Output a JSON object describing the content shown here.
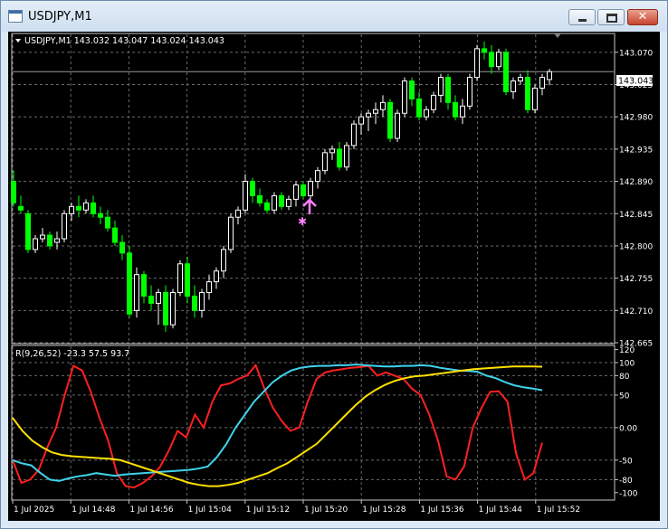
{
  "window": {
    "title": "USDJPY,M1",
    "minimize_glyph": "–",
    "maximize_glyph": "□",
    "close_glyph": "✕"
  },
  "main_chart": {
    "header": "USDJPY,M1  143.032 143.047 143.024 143.043",
    "current_price": "143.043",
    "bg_color": "#000000",
    "bull_color": "#ffffff",
    "bear_color": "#00ff00",
    "price_axis_ticks": [
      "143.070",
      "143.025",
      "142.980",
      "142.935",
      "142.890",
      "142.845",
      "142.800",
      "142.755",
      "142.710",
      "142.665"
    ]
  },
  "indicator": {
    "header": "R(9,26,52) -23.3 57.5 93.7",
    "axis_ticks": [
      "120",
      "100",
      "80",
      "50",
      "0.00",
      "-50",
      "-80",
      "-100"
    ]
  },
  "time_axis": [
    "1 Jul 2025",
    "1 Jul 14:48",
    "1 Jul 14:56",
    "1 Jul 15:04",
    "1 Jul 15:12",
    "1 Jul 15:20",
    "1 Jul 15:28",
    "1 Jul 15:36",
    "1 Jul 15:44",
    "1 Jul 15:52"
  ],
  "chart_data": [
    {
      "type": "candlestick",
      "title": "USDJPY,M1",
      "ylim": [
        142.665,
        143.095
      ],
      "series": [
        {
          "name": "USDJPY",
          "ohlc": [
            [
              142.89,
              142.905,
              142.855,
              142.86
            ],
            [
              142.855,
              142.87,
              142.845,
              142.85
            ],
            [
              142.845,
              142.85,
              142.79,
              142.795
            ],
            [
              142.795,
              142.815,
              142.79,
              142.81
            ],
            [
              142.81,
              142.825,
              142.805,
              142.815
            ],
            [
              142.815,
              142.82,
              142.795,
              142.8
            ],
            [
              142.805,
              142.82,
              142.795,
              142.81
            ],
            [
              142.81,
              142.85,
              142.805,
              142.845
            ],
            [
              142.845,
              142.86,
              142.835,
              142.855
            ],
            [
              142.855,
              142.87,
              142.84,
              142.85
            ],
            [
              142.85,
              142.865,
              142.845,
              142.86
            ],
            [
              142.86,
              142.87,
              142.84,
              142.845
            ],
            [
              142.845,
              142.855,
              142.83,
              142.84
            ],
            [
              142.84,
              142.85,
              142.82,
              142.825
            ],
            [
              142.825,
              142.835,
              142.8,
              142.805
            ],
            [
              142.805,
              142.815,
              142.78,
              142.79
            ],
            [
              142.79,
              142.8,
              142.7,
              142.705
            ],
            [
              142.71,
              142.77,
              142.7,
              142.76
            ],
            [
              142.76,
              142.765,
              142.72,
              142.73
            ],
            [
              142.73,
              142.745,
              142.71,
              142.72
            ],
            [
              142.72,
              142.74,
              142.69,
              142.735
            ],
            [
              142.735,
              142.745,
              142.68,
              142.69
            ],
            [
              142.69,
              142.74,
              142.685,
              142.735
            ],
            [
              142.735,
              142.78,
              142.73,
              142.775
            ],
            [
              142.775,
              142.785,
              142.72,
              142.73
            ],
            [
              142.73,
              142.745,
              142.7,
              142.71
            ],
            [
              142.71,
              142.74,
              142.7,
              142.735
            ],
            [
              142.735,
              142.76,
              142.725,
              142.75
            ],
            [
              142.75,
              142.77,
              142.74,
              142.765
            ],
            [
              142.765,
              142.8,
              142.755,
              142.795
            ],
            [
              142.795,
              142.845,
              142.79,
              142.84
            ],
            [
              142.84,
              142.855,
              142.83,
              142.85
            ],
            [
              142.85,
              142.9,
              142.845,
              142.89
            ],
            [
              142.89,
              142.895,
              142.86,
              142.87
            ],
            [
              142.87,
              142.88,
              142.855,
              142.86
            ],
            [
              142.86,
              142.865,
              142.845,
              142.85
            ],
            [
              142.85,
              142.875,
              142.845,
              142.87
            ],
            [
              142.87,
              142.875,
              142.85,
              142.855
            ],
            [
              142.855,
              142.87,
              142.85,
              142.865
            ],
            [
              142.865,
              142.89,
              142.855,
              142.885
            ],
            [
              142.885,
              142.89,
              142.865,
              142.87
            ],
            [
              142.87,
              142.895,
              142.865,
              142.89
            ],
            [
              142.89,
              142.91,
              142.88,
              142.905
            ],
            [
              142.905,
              142.935,
              142.9,
              142.93
            ],
            [
              142.93,
              142.94,
              142.92,
              142.935
            ],
            [
              142.935,
              142.945,
              142.905,
              142.91
            ],
            [
              142.91,
              142.945,
              142.905,
              142.94
            ],
            [
              142.94,
              142.975,
              142.935,
              142.97
            ],
            [
              142.97,
              142.985,
              142.955,
              142.98
            ],
            [
              142.98,
              142.99,
              142.96,
              142.985
            ],
            [
              142.985,
              143.0,
              142.97,
              142.99
            ],
            [
              142.99,
              143.01,
              142.98,
              143.0
            ],
            [
              143.0,
              143.005,
              142.945,
              142.95
            ],
            [
              142.95,
              142.99,
              142.945,
              142.985
            ],
            [
              142.985,
              143.035,
              142.98,
              143.03
            ],
            [
              143.03,
              143.035,
              142.995,
              143.005
            ],
            [
              143.005,
              143.015,
              142.975,
              142.98
            ],
            [
              142.98,
              142.995,
              142.975,
              142.99
            ],
            [
              142.99,
              143.015,
              142.985,
              143.01
            ],
            [
              143.01,
              143.04,
              143.0,
              143.035
            ],
            [
              143.035,
              143.04,
              142.99,
              143.0
            ],
            [
              143.0,
              143.01,
              142.975,
              142.98
            ],
            [
              142.98,
              143.005,
              142.97,
              142.995
            ],
            [
              142.995,
              143.04,
              142.99,
              143.035
            ],
            [
              143.035,
              143.08,
              143.03,
              143.075
            ],
            [
              143.075,
              143.085,
              143.06,
              143.07
            ],
            [
              143.07,
              143.08,
              143.04,
              143.05
            ],
            [
              143.05,
              143.075,
              143.045,
              143.07
            ],
            [
              143.07,
              143.075,
              143.01,
              143.015
            ],
            [
              143.015,
              143.035,
              143.005,
              143.03
            ],
            [
              143.03,
              143.04,
              143.025,
              143.035
            ],
            [
              143.035,
              143.045,
              142.985,
              142.99
            ],
            [
              142.99,
              143.025,
              142.985,
              143.02
            ],
            [
              143.02,
              143.04,
              143.01,
              143.035
            ],
            [
              143.032,
              143.047,
              143.024,
              143.043
            ]
          ]
        }
      ],
      "annotations": [
        {
          "type": "buy-arrow",
          "bar_index": 41,
          "price": 142.865
        }
      ]
    },
    {
      "type": "line",
      "title": "R(9,26,52)",
      "ylim": [
        -110,
        125
      ],
      "series": [
        {
          "name": "R9",
          "color": "#ff2020",
          "values": [
            -50,
            -85,
            -80,
            -65,
            -30,
            0,
            50,
            95,
            88,
            55,
            15,
            -20,
            -70,
            -90,
            -92,
            -85,
            -75,
            -60,
            -35,
            -5,
            -15,
            20,
            0,
            40,
            65,
            68,
            75,
            80,
            96,
            60,
            30,
            10,
            -5,
            0,
            40,
            75,
            85,
            88,
            90,
            92,
            93,
            95,
            80,
            85,
            80,
            75,
            60,
            50,
            20,
            -20,
            -75,
            -80,
            -60,
            0,
            30,
            55,
            56,
            40,
            -40,
            -80,
            -70,
            -23.3
          ]
        },
        {
          "name": "R26",
          "color": "#3fd3ec",
          "values": [
            -50,
            -55,
            -58,
            -70,
            -80,
            -82,
            -78,
            -75,
            -73,
            -70,
            -72,
            -74,
            -72,
            -71,
            -70,
            -69,
            -68,
            -67,
            -66,
            -65,
            -63,
            -60,
            -45,
            -25,
            0,
            20,
            40,
            55,
            70,
            80,
            88,
            92,
            94,
            95,
            95,
            96,
            96,
            97,
            96,
            95,
            94,
            94,
            95,
            95,
            96,
            95,
            92,
            90,
            88,
            87,
            86,
            80,
            76,
            70,
            65,
            62,
            60,
            57.5
          ]
        },
        {
          "name": "R52",
          "color": "#ffe000",
          "values": [
            15,
            -5,
            -20,
            -30,
            -38,
            -42,
            -44,
            -45,
            -46,
            -47,
            -48,
            -50,
            -55,
            -60,
            -65,
            -70,
            -75,
            -80,
            -85,
            -88,
            -90,
            -90,
            -88,
            -85,
            -80,
            -75,
            -70,
            -62,
            -55,
            -45,
            -35,
            -25,
            -10,
            5,
            20,
            35,
            48,
            58,
            66,
            72,
            76,
            79,
            80,
            82,
            84,
            86,
            88,
            90,
            91,
            92,
            93,
            94,
            94,
            94,
            93.7
          ]
        }
      ]
    }
  ]
}
